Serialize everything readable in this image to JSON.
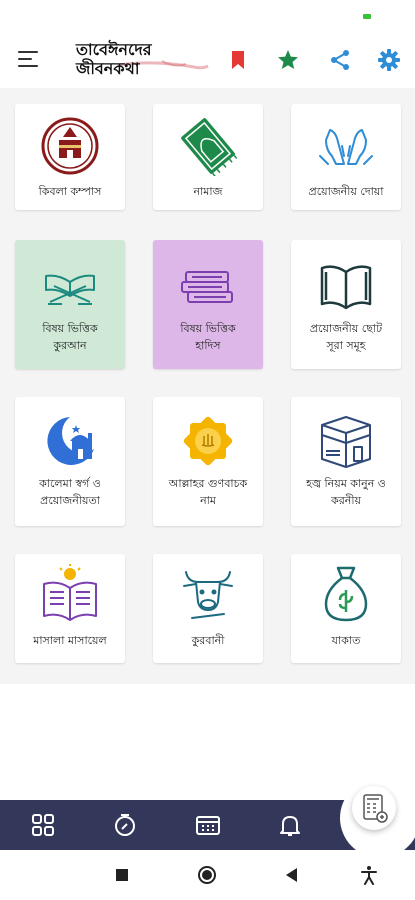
{
  "app": {
    "title": "তাবেঈনদের জীবনকথা"
  },
  "toolbar": {
    "menu_icon": "hamburger-menu-icon",
    "bookmark_icon": "bookmark-icon",
    "favorite_icon": "star-icon",
    "share_icon": "share-icon",
    "settings_icon": "gear-icon"
  },
  "colors": {
    "bookmark": "#e53935",
    "star": "#1e8a4a",
    "share": "#2f8dd6",
    "gear": "#2f8dd6",
    "maroon": "#8b1a1a",
    "green": "#1e8a4a",
    "teal": "#1d8a80",
    "purple": "#7b3fb0",
    "nav_bg": "#33375a",
    "card_green_bg": "#cfe9d6",
    "card_purple_bg": "#ddb7e8"
  },
  "grid": {
    "items": [
      {
        "label": "কিবলা কম্পাস",
        "icon": "kaaba-compass-icon"
      },
      {
        "label": "নামাজ",
        "icon": "prayer-mat-icon"
      },
      {
        "label": "প্রয়োজনীয় দোয়া",
        "icon": "praying-hands-icon"
      },
      {
        "label": "বিষয় ভিত্তিক কুরআন",
        "icon": "quran-stand-icon"
      },
      {
        "label": "বিষয় ভিত্তিক হাদিস",
        "icon": "books-stack-icon"
      },
      {
        "label": "প্রয়োজনীয় ছোট সূরা সমূহ",
        "icon": "open-book-icon"
      },
      {
        "label": "কালেমা স্বর্গ ও প্রয়োজনীয়তা",
        "icon": "crescent-mosque-icon"
      },
      {
        "label": "আল্লাহর গুণবাচক নাম",
        "icon": "allah-star-icon"
      },
      {
        "label": "হজ্ব নিয়ম কানুন ও করনীয়",
        "icon": "kaaba-icon"
      },
      {
        "label": "মাসালা মাসায়েল",
        "icon": "book-lightbulb-icon"
      },
      {
        "label": "কুরবানী",
        "icon": "cow-icon"
      },
      {
        "label": "যাকাত",
        "icon": "money-bag-icon"
      }
    ]
  },
  "bottom_nav": {
    "items": [
      {
        "icon": "grid-icon"
      },
      {
        "icon": "compass-icon"
      },
      {
        "icon": "calendar-icon"
      },
      {
        "icon": "bell-icon"
      }
    ],
    "fab_icon": "calculator-icon"
  },
  "system_nav": {
    "items": [
      {
        "icon": "recents-square-icon"
      },
      {
        "icon": "home-circle-icon"
      },
      {
        "icon": "back-triangle-icon"
      },
      {
        "icon": "accessibility-icon"
      }
    ]
  }
}
